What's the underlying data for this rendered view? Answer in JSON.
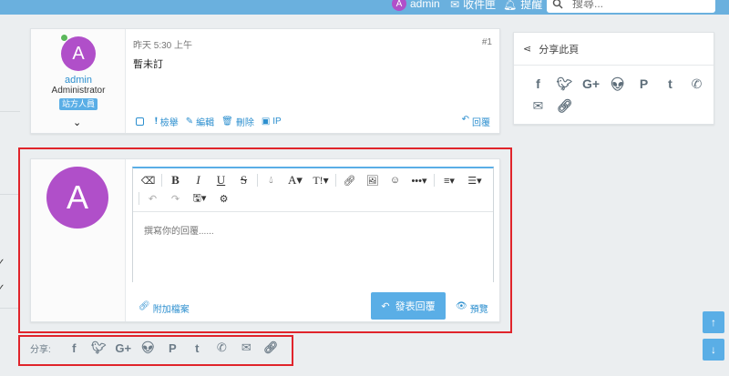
{
  "topbar": {
    "user_initial": "A",
    "user_name": "admin",
    "inbox_label": "收件匣",
    "notify_label": "提醒",
    "search_placeholder": "搜尋..."
  },
  "post": {
    "avatar_initial": "A",
    "username": "admin",
    "role": "Administrator",
    "badge": "站方人員",
    "timestamp": "昨天 5:30 上午",
    "post_number": "#1",
    "content": "暫未訂",
    "actions": {
      "report": "檢舉",
      "edit": "編輯",
      "delete": "刪除",
      "ip": "IP",
      "reply": "回覆"
    }
  },
  "composer": {
    "avatar_initial": "A",
    "placeholder": "撰寫你的回覆......",
    "attach_label": "附加檔案",
    "submit_label": "發表回覆",
    "preview_label": "預覽",
    "toolbar": {
      "bold": "B",
      "italic": "I",
      "underline": "U",
      "strike": "S",
      "font": "A",
      "size": "T!"
    }
  },
  "share_bottom": {
    "label": "分享:",
    "icons": [
      "facebook-icon",
      "twitter-icon",
      "google-plus-icon",
      "reddit-icon",
      "pinterest-icon",
      "tumblr-icon",
      "whatsapp-icon",
      "email-icon",
      "link-icon"
    ]
  },
  "share_panel": {
    "title": "分享此頁",
    "icons": [
      "facebook-icon",
      "twitter-icon",
      "google-plus-icon",
      "reddit-icon",
      "pinterest-icon",
      "tumblr-icon",
      "whatsapp-icon",
      "email-icon",
      "link-icon"
    ]
  },
  "colors": {
    "accent": "#5aaee6",
    "avatar": "#b04fc9",
    "link": "#2c8fcf",
    "highlight": "#e0242b"
  }
}
